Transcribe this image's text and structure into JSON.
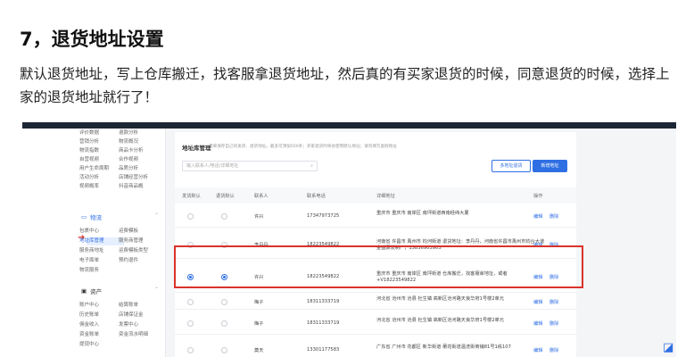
{
  "heading": "7，退货地址设置",
  "paragraph": "默认退货地址，写上仓库搬迁，找客服拿退货地址，然后真的有买家退货的时候，同意退货的时候，选择上家的退货地址就行了！",
  "sidebar": {
    "rows_top": [
      [
        "评价数据",
        "退款分析"
      ],
      [
        "营销分析",
        "物流概况"
      ],
      [
        "物流指数",
        "商品卡分析"
      ],
      [
        "自营视频",
        "合作视频"
      ],
      [
        "用户生命周期",
        "品质分析"
      ],
      [
        "活动分析",
        "店铺经营分析"
      ],
      [
        "视频概率",
        "抖音商品概"
      ]
    ],
    "logistics_section": "物流",
    "logistics_rows": [
      [
        "包裹中心",
        "运费模板"
      ],
      [
        "地址库管理",
        "服务商管理"
      ],
      [
        "服务商地址",
        "运费模板类型"
      ],
      [
        "电子面单",
        "预约退件"
      ],
      [
        "物流服务",
        ""
      ]
    ],
    "assets_section": "资产",
    "assets_rows": [
      [
        "账户中心",
        "结算账单"
      ],
      [
        "历史账单",
        "店铺保证金"
      ],
      [
        "佣金收入",
        "发票中心"
      ],
      [
        "资金账单",
        "资金流水明细"
      ],
      [
        "提现中心",
        ""
      ]
    ]
  },
  "panel": {
    "title": "地址库管理",
    "desc": "用来保存自己的发货、退货地址，最多可添加500条；买家退货时将会使用默认地址；请勿填写虚假地址",
    "search_placeholder": "输入联系人/电话/详细地址",
    "btn_multi": "多地址退货",
    "btn_new": "新增地址",
    "columns": [
      "发货默认",
      "退货默认",
      "联系人",
      "联系电话",
      "详细地址",
      "操作"
    ],
    "rows": [
      {
        "ship": false,
        "ret": false,
        "name": "许兴",
        "phone": "17347973725",
        "addr": "重庆市 重庆市 南岸区 南坪街道西南经纬大厦",
        "edit": "编辑",
        "del": "删除"
      },
      {
        "ship": false,
        "ret": false,
        "name": "李丹丹",
        "phone": "18223549822",
        "addr": "河南省 许昌市 禹州市 钧河街道 退货地址：李丹丹，河南省许昌市禹州市钧台大道金盛源发制厂，15836903903",
        "edit": "编辑",
        "del": "删除"
      },
      {
        "ship": true,
        "ret": true,
        "name": "许兴",
        "phone": "18223549822",
        "addr": "重庆市 重庆市 南岸区 南坪街道 仓库搬迁，找客服拿地址，或者+V18223549822",
        "edit": "编辑",
        "del": "删除"
      },
      {
        "ship": false,
        "ret": false,
        "name": "梅子",
        "phone": "18311333719",
        "addr": "河北省 沧州市 沧县 杜生镇 高新区沧河路天良华府1号楼2单元",
        "edit": "编辑",
        "del": "删除"
      },
      {
        "ship": false,
        "ret": false,
        "name": "梅子",
        "phone": "18311333719",
        "addr": "河北省 沧州市 沧县 杜生镇 高新区沧河路天良华府1号楼2单元",
        "edit": "编辑",
        "del": "删除"
      },
      {
        "ship": false,
        "ret": false,
        "name": "奠天",
        "phone": "13301177583",
        "addr": "广东省 广州市 花都区 新华街道 莆花街道温洗街商铺81号1栋107",
        "edit": "编辑",
        "del": "删除"
      }
    ]
  },
  "colors": {
    "accent": "#2f6fe4",
    "highlight": "#d9332b"
  }
}
